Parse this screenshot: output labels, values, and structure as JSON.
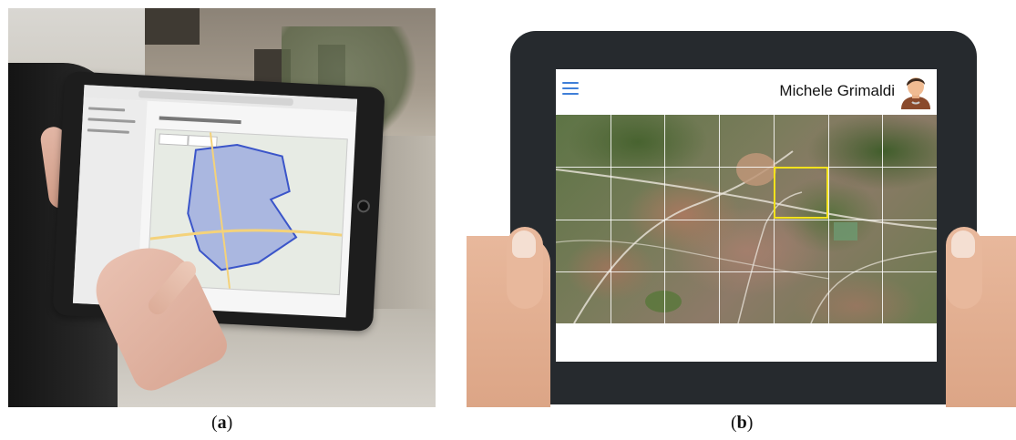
{
  "panel_b": {
    "user_name": "Michele Grimaldi",
    "menu_icon": "hamburger-menu-icon",
    "avatar_icon": "user-avatar-icon",
    "accent_color": "#3f7fd8",
    "highlight_color": "#f2e21c",
    "grid": {
      "rows": 4,
      "columns": 7,
      "selected_row": 1,
      "selected_col": 4
    }
  },
  "captions": {
    "a": {
      "open": "(",
      "letter": "a",
      "close": ")"
    },
    "b": {
      "open": "(",
      "letter": "b",
      "close": ")"
    }
  }
}
